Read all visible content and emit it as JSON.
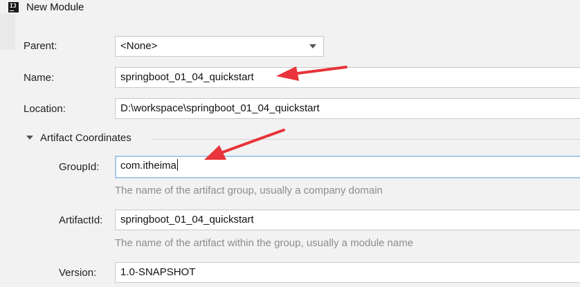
{
  "window": {
    "title": "New Module",
    "app_icon_text": "IJ"
  },
  "form": {
    "parent": {
      "label": "Parent:",
      "value": "<None>"
    },
    "name": {
      "label": "Name:",
      "value": "springboot_01_04_quickstart"
    },
    "location": {
      "label": "Location:",
      "value": "D:\\workspace\\springboot_01_04_quickstart"
    }
  },
  "artifact": {
    "section_title": "Artifact Coordinates",
    "group_id": {
      "label": "GroupId:",
      "value": "com.itheima",
      "hint": "The name of the artifact group, usually a company domain"
    },
    "artifact_id": {
      "label": "ArtifactId:",
      "value": "springboot_01_04_quickstart",
      "hint": "The name of the artifact within the group, usually a module name"
    },
    "version": {
      "label": "Version:",
      "value": "1.0-SNAPSHOT"
    }
  },
  "annotations": {
    "arrow_color": "#e8343a",
    "focus_border_color": "#a8c8ec"
  }
}
